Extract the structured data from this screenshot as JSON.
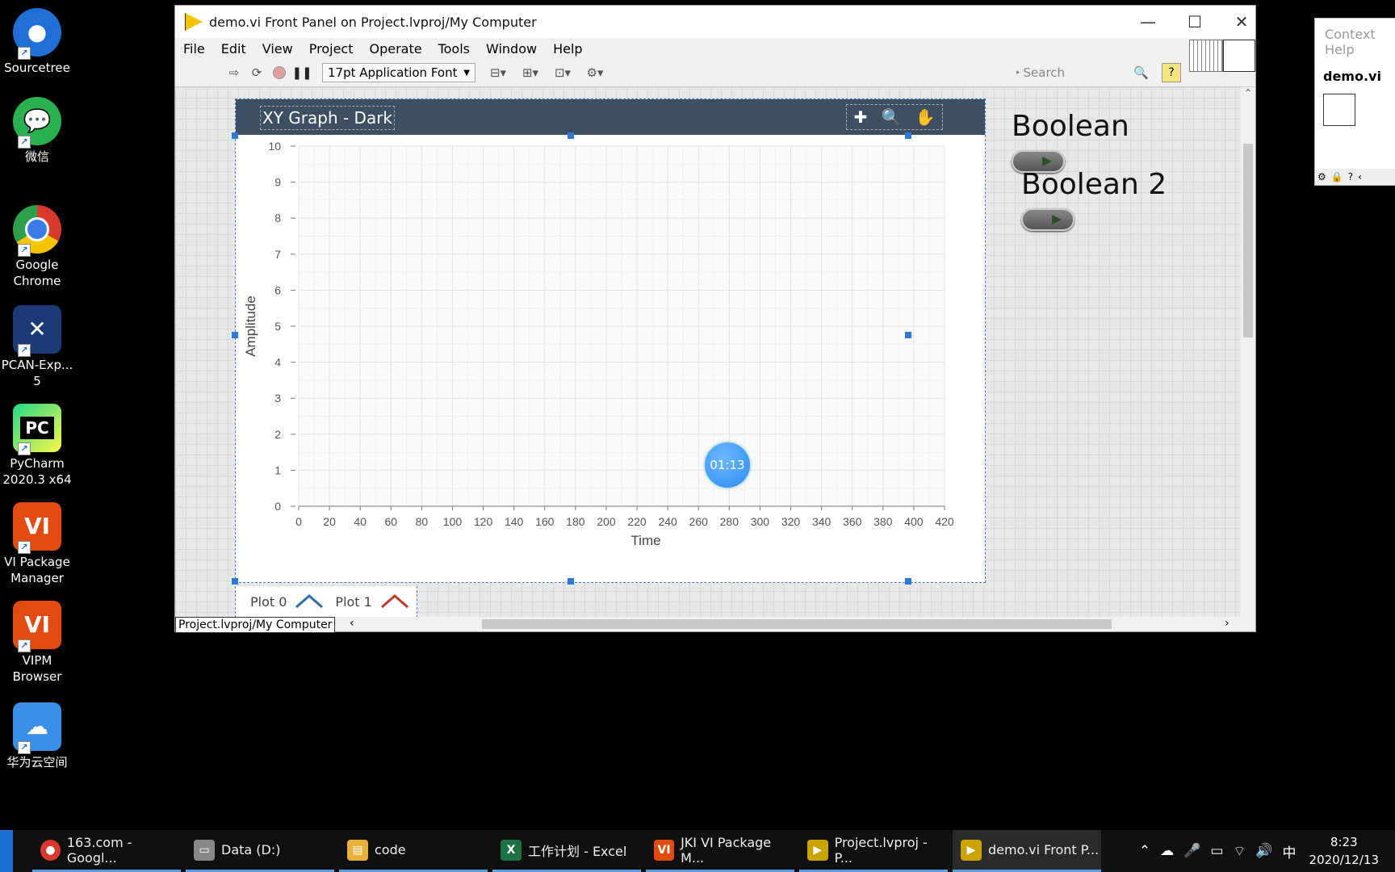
{
  "desktop_icons": [
    {
      "label": "Sourcetree",
      "color": "#1f6fd6"
    },
    {
      "label": "微信",
      "color": "#2ab04f"
    },
    {
      "label": "Google Chrome",
      "color": "#d93a2e"
    },
    {
      "label": "PCAN-Exp... 5",
      "color": "#1b3b78"
    },
    {
      "label": "PyCharm 2020.3 x64",
      "color": "#1f8c5c"
    },
    {
      "label": "VI Package Manager",
      "color": "#e14b10"
    },
    {
      "label": "VIPM Browser",
      "color": "#e14b10"
    },
    {
      "label": "华为云空间",
      "color": "#3c8fe8"
    }
  ],
  "window": {
    "title": "demo.vi Front Panel on Project.lvproj/My Computer",
    "minimize": "—",
    "maximize": "☐",
    "close": "✕"
  },
  "menu": [
    "File",
    "Edit",
    "View",
    "Project",
    "Operate",
    "Tools",
    "Window",
    "Help"
  ],
  "toolbar": {
    "font_select": "17pt Application Font",
    "search_placeholder": "Search",
    "help": "?"
  },
  "graph": {
    "label": "XY Graph - Dark",
    "header_color": "#3e4f63"
  },
  "chart_data": {
    "type": "line",
    "title": "XY Graph - Dark",
    "xlabel": "Time",
    "ylabel": "Amplitude",
    "xlim": [
      0,
      420
    ],
    "ylim": [
      0,
      10
    ],
    "x_ticks": [
      0,
      20,
      40,
      60,
      80,
      100,
      120,
      140,
      160,
      180,
      200,
      220,
      240,
      260,
      280,
      300,
      320,
      340,
      360,
      380,
      400,
      420
    ],
    "y_ticks": [
      0,
      1,
      2,
      3,
      4,
      5,
      6,
      7,
      8,
      9,
      10
    ],
    "grid": true,
    "legend_position": "bottom-left",
    "series": [
      {
        "name": "Plot 0",
        "color": "#2e6fa8",
        "values": []
      },
      {
        "name": "Plot 1",
        "color": "#c0392b",
        "values": []
      }
    ]
  },
  "timer": "01:13",
  "booleans": [
    {
      "label": "Boolean"
    },
    {
      "label": "Boolean 2"
    }
  ],
  "statusbar": {
    "path": "Project.lvproj/My Computer"
  },
  "context_help": {
    "title": "Context Help",
    "vi_name": "demo.vi"
  },
  "taskbar": {
    "items": [
      {
        "label": "163.com - Googl...",
        "color": "#d93a2e",
        "icon": "chrome-icon"
      },
      {
        "label": "Data (D:)",
        "color": "#888888",
        "icon": "drive-icon"
      },
      {
        "label": "code",
        "color": "#e8b23a",
        "icon": "folder-icon"
      },
      {
        "label": "工作计划 - Excel",
        "color": "#1e7145",
        "icon": "excel-icon"
      },
      {
        "label": "JKI VI Package M...",
        "color": "#e14b10",
        "icon": "vipm-icon"
      },
      {
        "label": "Project.lvproj - P...",
        "color": "#c9a400",
        "icon": "labview-icon"
      },
      {
        "label": "demo.vi Front P...",
        "color": "#c9a400",
        "icon": "labview-icon"
      }
    ],
    "ime": "中",
    "time": "8:23",
    "date": "2020/12/13"
  }
}
